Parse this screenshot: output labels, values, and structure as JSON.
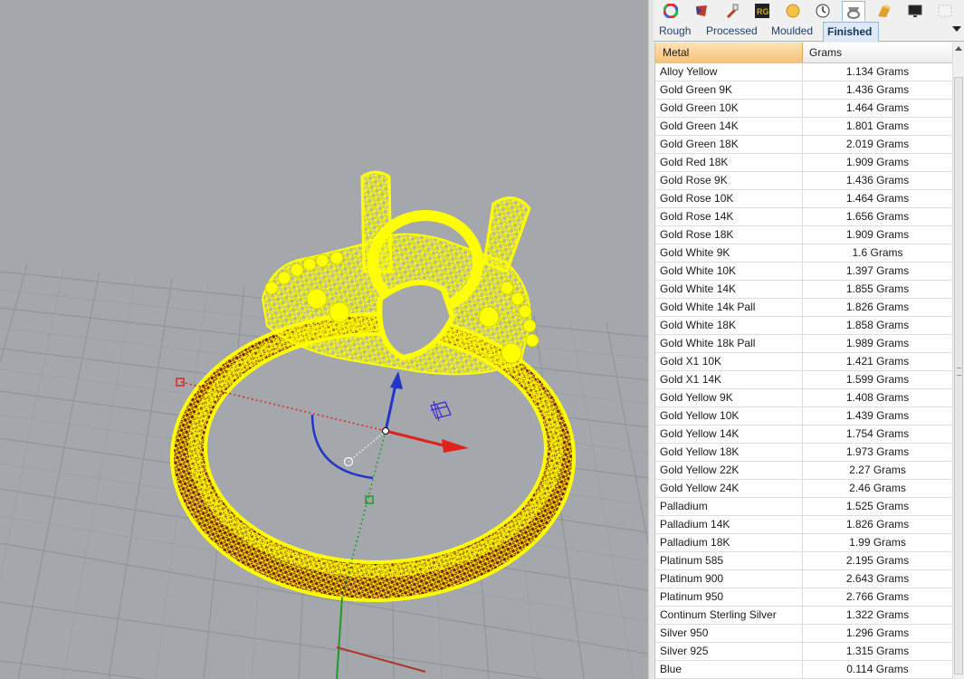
{
  "toolbar": {
    "icons": [
      "color-wheel-icon",
      "material-icon",
      "paint-icon",
      "rg-icon",
      "gem-icon",
      "clock-icon",
      "ring-weight-icon",
      "pattern-icon",
      "display-icon",
      "more-icon"
    ],
    "rg_label": "RG"
  },
  "tabs": [
    {
      "label": "Rough",
      "active": false
    },
    {
      "label": "Processed",
      "active": false
    },
    {
      "label": "Moulded",
      "active": false
    },
    {
      "label": "Finished",
      "active": true
    }
  ],
  "grid": {
    "columns": {
      "metal": "Metal",
      "grams": "Grams"
    },
    "rows": [
      {
        "metal": "Alloy Yellow",
        "grams": "1.134 Grams"
      },
      {
        "metal": "Gold Green 9K",
        "grams": "1.436 Grams"
      },
      {
        "metal": "Gold Green 10K",
        "grams": "1.464 Grams"
      },
      {
        "metal": "Gold Green 14K",
        "grams": "1.801 Grams"
      },
      {
        "metal": "Gold Green 18K",
        "grams": "2.019 Grams"
      },
      {
        "metal": "Gold Red 18K",
        "grams": "1.909 Grams"
      },
      {
        "metal": "Gold Rose 9K",
        "grams": "1.436 Grams"
      },
      {
        "metal": "Gold Rose 10K",
        "grams": "1.464 Grams"
      },
      {
        "metal": "Gold Rose 14K",
        "grams": "1.656 Grams"
      },
      {
        "metal": "Gold Rose 18K",
        "grams": "1.909 Grams"
      },
      {
        "metal": "Gold White 9K",
        "grams": "1.6 Grams"
      },
      {
        "metal": "Gold White 10K",
        "grams": "1.397 Grams"
      },
      {
        "metal": "Gold White 14K",
        "grams": "1.855 Grams"
      },
      {
        "metal": "Gold White 14k Pall",
        "grams": "1.826 Grams"
      },
      {
        "metal": "Gold White 18K",
        "grams": "1.858 Grams"
      },
      {
        "metal": "Gold White 18k Pall",
        "grams": "1.989 Grams"
      },
      {
        "metal": "Gold X1 10K",
        "grams": "1.421 Grams"
      },
      {
        "metal": "Gold X1 14K",
        "grams": "1.599 Grams"
      },
      {
        "metal": "Gold Yellow 9K",
        "grams": "1.408 Grams"
      },
      {
        "metal": "Gold Yellow 10K",
        "grams": "1.439 Grams"
      },
      {
        "metal": "Gold Yellow 14K",
        "grams": "1.754 Grams"
      },
      {
        "metal": "Gold Yellow 18K",
        "grams": "1.973 Grams"
      },
      {
        "metal": "Gold Yellow 22K",
        "grams": "2.27 Grams"
      },
      {
        "metal": "Gold Yellow 24K",
        "grams": "2.46 Grams"
      },
      {
        "metal": "Palladium",
        "grams": "1.525 Grams"
      },
      {
        "metal": "Palladium 14K",
        "grams": "1.826 Grams"
      },
      {
        "metal": "Palladium 18K",
        "grams": "1.99 Grams"
      },
      {
        "metal": "Platinum 585",
        "grams": "2.195 Grams"
      },
      {
        "metal": "Platinum 900",
        "grams": "2.643 Grams"
      },
      {
        "metal": "Platinum 950",
        "grams": "2.766 Grams"
      },
      {
        "metal": "Continum Sterling Silver",
        "grams": "1.322 Grams"
      },
      {
        "metal": "Silver 950",
        "grams": "1.296 Grams"
      },
      {
        "metal": "Silver 925",
        "grams": "1.315 Grams"
      },
      {
        "metal": "Blue",
        "grams": "0.114 Grams"
      }
    ]
  },
  "viewport": {
    "background": "#a4a8ad",
    "wire_color": "#ffff00",
    "shade_color": "#7a1e08",
    "axis_colors": {
      "x": "#e0221c",
      "y": "#1f9a2a",
      "z": "#2236c8"
    }
  }
}
